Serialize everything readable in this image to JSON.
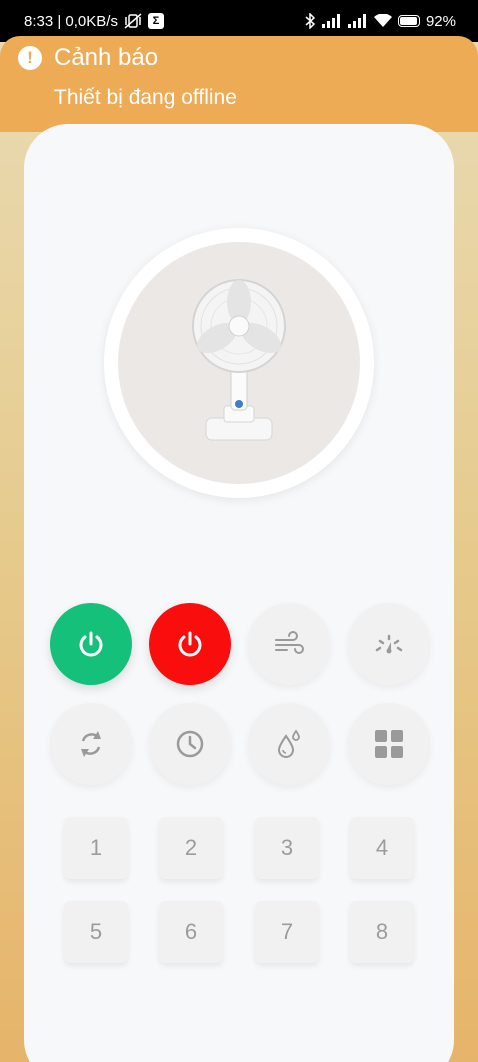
{
  "status_bar": {
    "time_net": "8:33 | 0,0KB/s",
    "sigma": "Σ",
    "battery": "92%",
    "battery_level": 0.92
  },
  "alert": {
    "title": "Cảnh báo",
    "message": "Thiết bị đang offline"
  },
  "controls": {
    "row1": [
      {
        "name": "power-on",
        "icon": "power-icon",
        "color": "#14c07a"
      },
      {
        "name": "power-off",
        "icon": "power-icon",
        "color": "#fa0d0d"
      },
      {
        "name": "wind-mode",
        "icon": "wind-icon"
      },
      {
        "name": "speed",
        "icon": "gauge-icon"
      }
    ],
    "row2": [
      {
        "name": "oscillate",
        "icon": "rotate-icon"
      },
      {
        "name": "timer",
        "icon": "clock-icon"
      },
      {
        "name": "humidify",
        "icon": "droplet-icon"
      },
      {
        "name": "more",
        "icon": "grid-icon"
      }
    ]
  },
  "number_keys": [
    "1",
    "2",
    "3",
    "4",
    "5",
    "6",
    "7",
    "8"
  ]
}
